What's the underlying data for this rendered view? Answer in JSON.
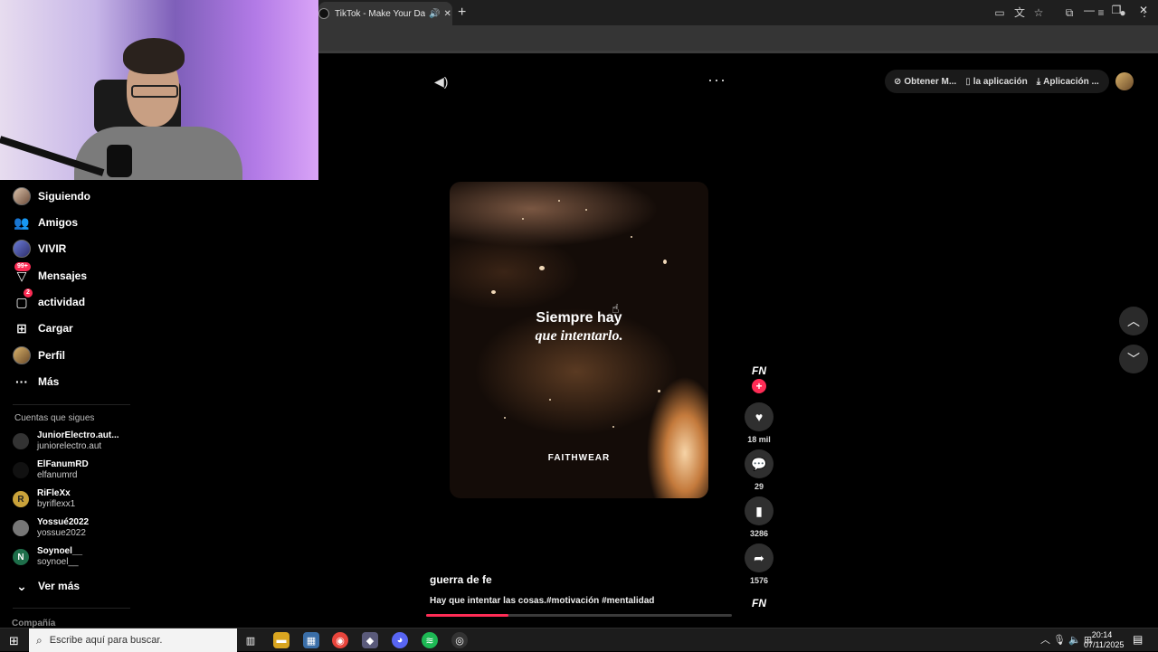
{
  "browser": {
    "tab_title": "TikTok - Make Your Day",
    "tab_audio_icon": "speaker-icon",
    "tab_close": "✕",
    "new_tab": "+",
    "window_controls": [
      "—",
      "❐",
      "✕"
    ]
  },
  "sidebar": {
    "items": [
      {
        "label": "Siguiendo",
        "icon": "avatar-icon"
      },
      {
        "label": "Amigos",
        "icon": "friends-icon"
      },
      {
        "label": "VIVIR",
        "icon": "live-icon"
      },
      {
        "label": "Mensajes",
        "icon": "messages-icon",
        "badge": "99+"
      },
      {
        "label": "actividad",
        "icon": "activity-icon",
        "badge": "2"
      },
      {
        "label": "Cargar",
        "icon": "upload-icon"
      },
      {
        "label": "Perfil",
        "icon": "profile-icon"
      },
      {
        "label": "Más",
        "icon": "more-icon"
      }
    ],
    "following_title": "Cuentas que sigues",
    "accounts": [
      {
        "name": "JuniorElectro.aut...",
        "user": "juniorelectro.aut",
        "initial": ""
      },
      {
        "name": "ElFanumRD",
        "user": "elfanumrd",
        "initial": ""
      },
      {
        "name": "RiFleXx",
        "user": "byriflexx1",
        "initial": "R"
      },
      {
        "name": "Yossué2022",
        "user": "yossue2022",
        "initial": ""
      },
      {
        "name": "Soynoel__",
        "user": "soynoel__",
        "initial": "N"
      }
    ],
    "see_more": "Ver más",
    "company": "Compañía"
  },
  "topbar": {
    "get_coins": "Obtener M...",
    "app": "la aplicación",
    "desktop_app": "Aplicación ..."
  },
  "video": {
    "line1": "Siempre hay",
    "line2": "que intentarlo.",
    "brand": "FAITHWEAR",
    "author": "guerra de fe",
    "description": "Hay que intentar las cosas.#motivación #mentalidad",
    "progress": 0.27
  },
  "actions": {
    "creator_logo": "FN",
    "likes": "18 mil",
    "comments": "29",
    "saves": "3286",
    "shares": "1576",
    "music_logo": "FN"
  },
  "taskbar": {
    "search_placeholder": "Escribe aquí para buscar.",
    "time": "20:14",
    "date": "07/11/2025"
  }
}
